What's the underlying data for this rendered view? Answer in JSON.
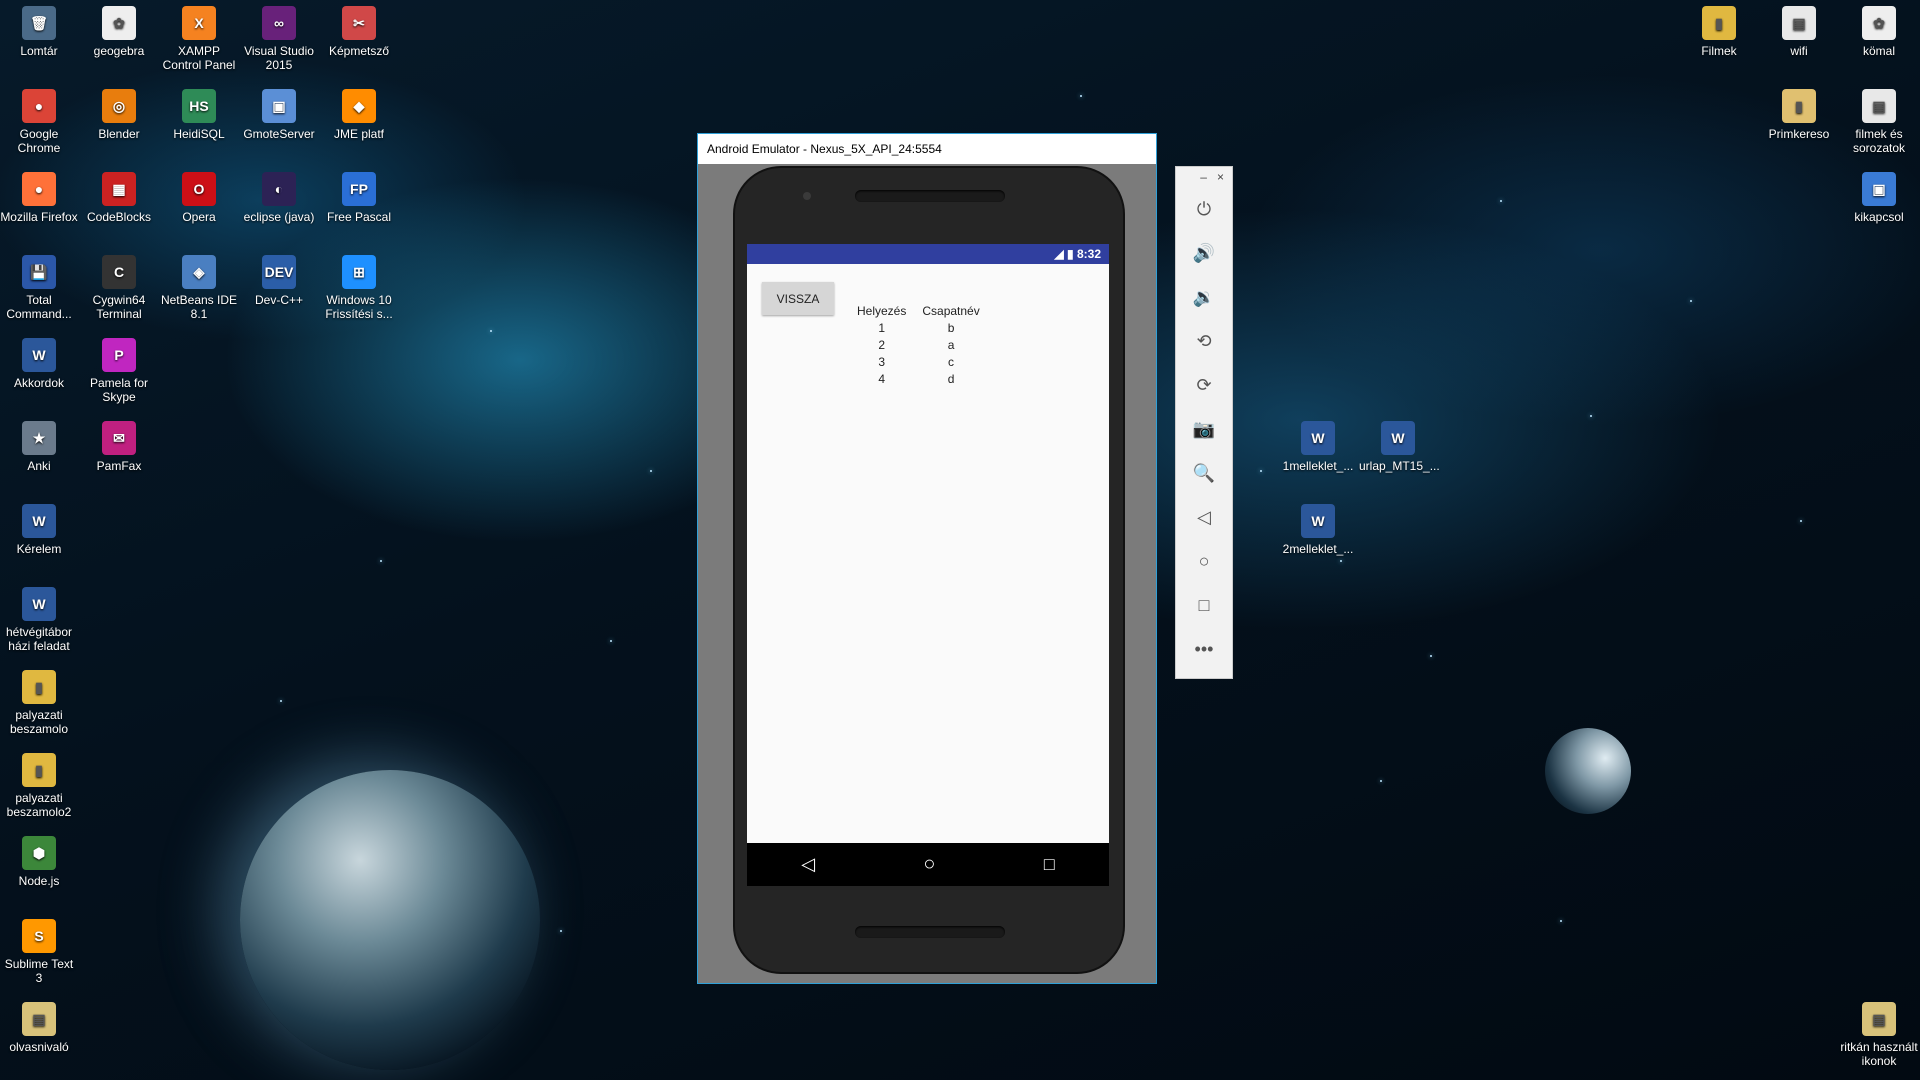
{
  "desktop": {
    "icons": [
      {
        "label": "Lomtár",
        "glyph": "🗑",
        "color": "#4a6a88"
      },
      {
        "label": "geogebra",
        "glyph": "✿",
        "color": "#eeeeee"
      },
      {
        "label": "XAMPP Control Panel",
        "glyph": "X",
        "color": "#f58220"
      },
      {
        "label": "Visual Studio 2015",
        "glyph": "∞",
        "color": "#68217a"
      },
      {
        "label": "Képmetsző",
        "glyph": "✂",
        "color": "#d04848"
      },
      {
        "label": "Google Chrome",
        "glyph": "●",
        "color": "#db4437"
      },
      {
        "label": "Blender",
        "glyph": "◎",
        "color": "#e87d0d"
      },
      {
        "label": "HeidiSQL",
        "glyph": "HS",
        "color": "#2e8b57"
      },
      {
        "label": "GmoteServer",
        "glyph": "▣",
        "color": "#5b8fd6"
      },
      {
        "label": "JME platf",
        "glyph": "◆",
        "color": "#ff8c00"
      },
      {
        "label": "Mozilla Firefox",
        "glyph": "●",
        "color": "#ff7139"
      },
      {
        "label": "CodeBlocks",
        "glyph": "▦",
        "color": "#cc2222"
      },
      {
        "label": "Opera",
        "glyph": "O",
        "color": "#cc0f16"
      },
      {
        "label": "eclipse (java)",
        "glyph": "◐",
        "color": "#2c2255"
      },
      {
        "label": "Free Pascal",
        "glyph": "FP",
        "color": "#2a6fd6"
      },
      {
        "label": "Total Command...",
        "glyph": "💾",
        "color": "#2b57a8"
      },
      {
        "label": "Cygwin64 Terminal",
        "glyph": "C",
        "color": "#333333"
      },
      {
        "label": "NetBeans IDE 8.1",
        "glyph": "◈",
        "color": "#4a7fc1"
      },
      {
        "label": "Dev-C++",
        "glyph": "DEV",
        "color": "#2b5ea8"
      },
      {
        "label": "Windows 10 Frissítési s...",
        "glyph": "⊞",
        "color": "#1e90ff"
      },
      {
        "label": "Akkordok",
        "glyph": "W",
        "color": "#2b579a"
      },
      {
        "label": "Pamela for Skype",
        "glyph": "P",
        "color": "#c026c0"
      },
      {
        "label": "Anki",
        "glyph": "★",
        "color": "#6b7b8c"
      },
      {
        "label": "PamFax",
        "glyph": "✉",
        "color": "#c02080"
      },
      {
        "label": "Kérelem",
        "glyph": "W",
        "color": "#2b579a"
      },
      {
        "label": "hétvégitábor házi feladat",
        "glyph": "W",
        "color": "#2b579a"
      },
      {
        "label": "palyazati beszamolo",
        "glyph": "▮",
        "color": "#e0b840"
      },
      {
        "label": "palyazati beszamolo2",
        "glyph": "▮",
        "color": "#e0b840"
      },
      {
        "label": "Node.js",
        "glyph": "⬢",
        "color": "#3c873a"
      },
      {
        "label": "Sublime Text 3",
        "glyph": "S",
        "color": "#ff9800"
      },
      {
        "label": "olvasnivaló",
        "glyph": "▤",
        "color": "#d8c27a"
      },
      {
        "label": "Filmek",
        "glyph": "▮",
        "color": "#e0b840"
      },
      {
        "label": "wifi",
        "glyph": "▤",
        "color": "#e8e8e8"
      },
      {
        "label": "kömal",
        "glyph": "✿",
        "color": "#eeeeee"
      },
      {
        "label": "Primkereso",
        "glyph": "▮",
        "color": "#e0c070"
      },
      {
        "label": "filmek és sorozatok",
        "glyph": "▤",
        "color": "#e8e8e8"
      },
      {
        "label": "kikapcsol",
        "glyph": "▣",
        "color": "#3a7bd5"
      },
      {
        "label": "1melleklet_...",
        "glyph": "W",
        "color": "#2b579a"
      },
      {
        "label": "urlap_MT15_...",
        "glyph": "W",
        "color": "#2b579a"
      },
      {
        "label": "2melleklet_...",
        "glyph": "W",
        "color": "#2b579a"
      },
      {
        "label": "ritkán használt ikonok",
        "glyph": "▤",
        "color": "#d8c27a"
      }
    ]
  },
  "emulator": {
    "title": "Android Emulator - Nexus_5X_API_24:5554",
    "status_time": "8:32",
    "back_button": "VISSZA",
    "table": {
      "headers": [
        "Helyezés",
        "Csapatnév"
      ],
      "rows": [
        [
          "1",
          "b"
        ],
        [
          "2",
          "a"
        ],
        [
          "3",
          "c"
        ],
        [
          "4",
          "d"
        ]
      ]
    },
    "nav": {
      "back": "◁",
      "home": "○",
      "recents": "□"
    }
  },
  "toolbar": {
    "minimize": "–",
    "close": "×",
    "buttons": [
      {
        "name": "power-icon",
        "glyph": "⏻"
      },
      {
        "name": "volume-up-icon",
        "glyph": "🔊"
      },
      {
        "name": "volume-down-icon",
        "glyph": "🔉"
      },
      {
        "name": "rotate-left-icon",
        "glyph": "⟲"
      },
      {
        "name": "rotate-right-icon",
        "glyph": "⟳"
      },
      {
        "name": "camera-icon",
        "glyph": "📷"
      },
      {
        "name": "zoom-icon",
        "glyph": "🔍"
      },
      {
        "name": "back-icon",
        "glyph": "◁"
      },
      {
        "name": "home-icon",
        "glyph": "○"
      },
      {
        "name": "overview-icon",
        "glyph": "□"
      },
      {
        "name": "more-icon",
        "glyph": "•••"
      }
    ]
  }
}
